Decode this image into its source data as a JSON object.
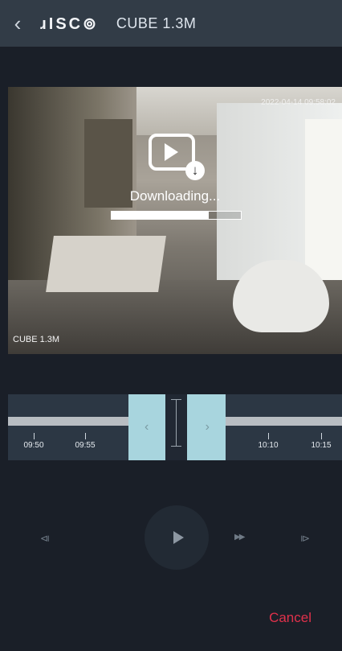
{
  "header": {
    "back_icon": "chevron-left-icon",
    "logo": "ɹISC⊚",
    "camera_name": "CUBE 1.3M"
  },
  "video": {
    "timestamp": "2022-04-14 09:58:02",
    "camera_overlay": "CUBE 1.3M",
    "download_label": "Downloading...",
    "download_progress": 0.75
  },
  "timeline": {
    "ticks": [
      "09:50",
      "09:55",
      "10:10",
      "10:15"
    ],
    "window_left_arrow": "‹",
    "window_right_arrow": "›"
  },
  "controls": {
    "skip_start_glyph": "⧏",
    "fast_forward_glyph": "▶▶",
    "skip_end_glyph": "⧐"
  },
  "footer": {
    "cancel_label": "Cancel"
  },
  "colors": {
    "header_bg": "#323c47",
    "timeline_bg": "#2c3744",
    "selection": "#a8d5de",
    "cancel": "#e0314b"
  }
}
